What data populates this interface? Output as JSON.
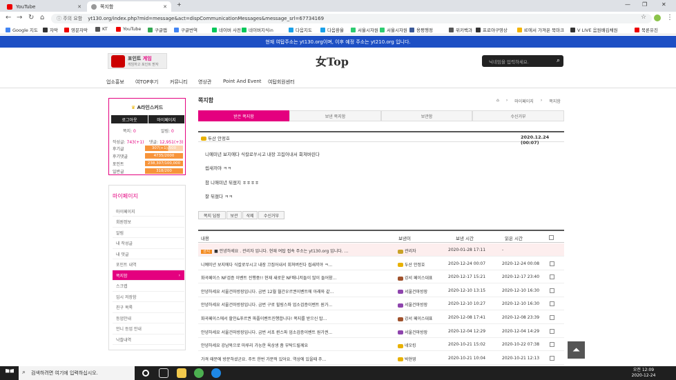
{
  "browser": {
    "tabs": [
      {
        "label": "YouTube",
        "icon_color": "#e00"
      },
      {
        "label": "쪽지함",
        "icon_color": "#777"
      }
    ],
    "new_tab": "+",
    "win": {
      "min": "—",
      "max": "❐",
      "close": "✕"
    },
    "nav": {
      "back": "←",
      "fwd": "→",
      "reload": "↻",
      "home": "⌂"
    },
    "security": "ⓘ 주의 요함",
    "url": "yt130.org/index.php?mid=message&act=dispCommunicationMessages&message_srl=67734169",
    "bookmarks": [
      "Google 지도",
      "자막",
      "영문자막",
      "KT",
      "YouTube",
      "구글맵",
      "구글번역",
      "네이버 사전",
      "네이버지식in",
      "다음지도",
      "다음환율",
      "서울시자원",
      "서울시자원",
      "용평행정",
      "위키백과",
      "프로야구영상",
      "IE에서 가져온 북마크",
      "V LIVE 음원배김채원",
      "북론유진"
    ]
  },
  "site": {
    "notice": "현재 여탑주소는 yt130.org이며, 이후 예정 주소는 yt210.org 입니다.",
    "game_title_a": "포인트 ",
    "game_title_b": "게임",
    "game_sub": "게임하고 포인트 받자",
    "logo": "女Top",
    "search_placeholder": "닉네임을 입력하세요.",
    "menu": [
      "업소홍보",
      "여TOP후기",
      "커뮤니티",
      "영상관",
      "Point And Event",
      "여탑회원센터"
    ]
  },
  "profile": {
    "name": "A라인스커드",
    "logout": "로그아웃",
    "mypage": "마이페이지",
    "note_label": "쪽지:",
    "note_val": "0",
    "alarm_label": "알림:",
    "alarm_val": "0",
    "posts_label": "작성글:",
    "posts_val": "743(+1)",
    "comments_label": "댓글:",
    "comments_val": "12,951(+3)",
    "stats": [
      {
        "label": "후기글",
        "value": "307(+1)/500",
        "fill": 0.61
      },
      {
        "label": "후기댓글",
        "value": "4735/2000",
        "fill": 1
      },
      {
        "label": "포인트",
        "value": "238,307/100,000",
        "fill": 1
      },
      {
        "label": "일반글",
        "value": "318/200",
        "fill": 1
      }
    ]
  },
  "mypage": {
    "title": "마이페이지",
    "items": [
      "마이페이지",
      "회원정보",
      "알림",
      "내 작성글",
      "내 댓글",
      "포인트 내역",
      "쪽지함",
      "스크랩",
      "임시 저장함",
      "친구 목록",
      "등업안내",
      "언니 등업 안내",
      "낙찰내역"
    ],
    "active_arrow": "›"
  },
  "main": {
    "title": "쪽지함",
    "crumb": [
      "⌂",
      "›",
      "마이페이지",
      "›",
      "쪽지함"
    ],
    "tabs": [
      "받은 쪽지함",
      "보낸 쪽지함",
      "보관함",
      "수신거부"
    ],
    "msg": {
      "sender": "두산 안정호",
      "date": "2020.12.24 (00:07)",
      "lines": [
        "니예미년 보지에다 식칼로쑤시고 내장 끄집어내서 회쳐버린다",
        "씹새끼야 ㅋㅋ",
        "참 니애미년 뒤졌지 ㅎㅎㅎㅎ",
        "잘 뒤졌다 ㅋㅋ"
      ]
    },
    "actions": [
      "쪽지 답장",
      "보관",
      "삭제",
      "수신거부"
    ],
    "list_head": {
      "content": "내용",
      "sender": "보낸이",
      "sent": "보낸 시간",
      "read": "읽은 시간"
    },
    "notice_badge": "공지",
    "rows": [
      {
        "content": "■ 안녕하세요 . 관리자 입니다. 현재 여탑 접속 주소는 yt130.org 입니다. ...",
        "sender": "관리자",
        "sent": "2020-01-28 17:11",
        "read": "-",
        "notice": true,
        "color": "#c9a227"
      },
      {
        "content": "니예미년 보지에다 식칼로쑤시고 내장 끄집어내서 회쳐버린다 씹새끼야 ㅋ...",
        "sender": "두산 안정호",
        "sent": "2020-12-24 00:07",
        "read": "2020-12-24 00:08",
        "color": "#e8b100"
      },
      {
        "content": "화곡페이스 NF검증 이벤트 진행중!! 현재 새로운 NF매니저들이 많이 들어왔...",
        "sender": "강서 페이스대표",
        "sent": "2020-12-17 15:21",
        "read": "2020-12-17 23:40",
        "color": "#a0522d"
      },
      {
        "content": "안녕하세요 서울건마방장입니다. 금번 12월 월간우르권이벤트에 아래와 같...",
        "sender": "서울건마방장",
        "sent": "2020-12-10 13:15",
        "read": "2020-12-10 16:30",
        "color": "#8e44ad"
      },
      {
        "content": "안녕하세요 서울건마방장입니다. 금번 구로 힐링스파 업소검증이벤트 원가...",
        "sender": "서울건마방장",
        "sent": "2020-12-10 10:27",
        "read": "2020-12-10 16:30",
        "color": "#8e44ad"
      },
      {
        "content": "화곡페이스에서 할인&푸르권 파플이벤트진행합니다! 쪽지를 받으신 탑...",
        "sender": "강서 페이스대표",
        "sent": "2020-12-08 17:41",
        "read": "2020-12-08 23:39",
        "color": "#a0522d"
      },
      {
        "content": "안녕하세요 서울건마방장입니다. 금번 서초 퀸스파 업소검증이벤트 원가권...",
        "sender": "서울건마방장",
        "sent": "2020-12-04 12:29",
        "read": "2020-12-04 14:29",
        "color": "#8e44ad"
      },
      {
        "content": "안녕하세요 강남묵으로 마루리 가능한 육상생 좀 부탁드릴께요",
        "sender": "네오킹",
        "sent": "2020-10-21 15:02",
        "read": "2020-10-22 07:38",
        "color": "#e8b100"
      },
      {
        "content": "가격 때문에 방문하셨군요. 주트 한번 가분적 있어요. 역상에 있을때 주...",
        "sender": "박현영",
        "sent": "2020-10-21 10:04",
        "read": "2020-10-21 12:13",
        "color": "#e8b100"
      }
    ],
    "totop": "⏶"
  },
  "taskbar": {
    "search_placeholder": "검색하려면 여기에 입력하십시오.",
    "time": "오전 12:09",
    "date": "2020-12-24"
  }
}
